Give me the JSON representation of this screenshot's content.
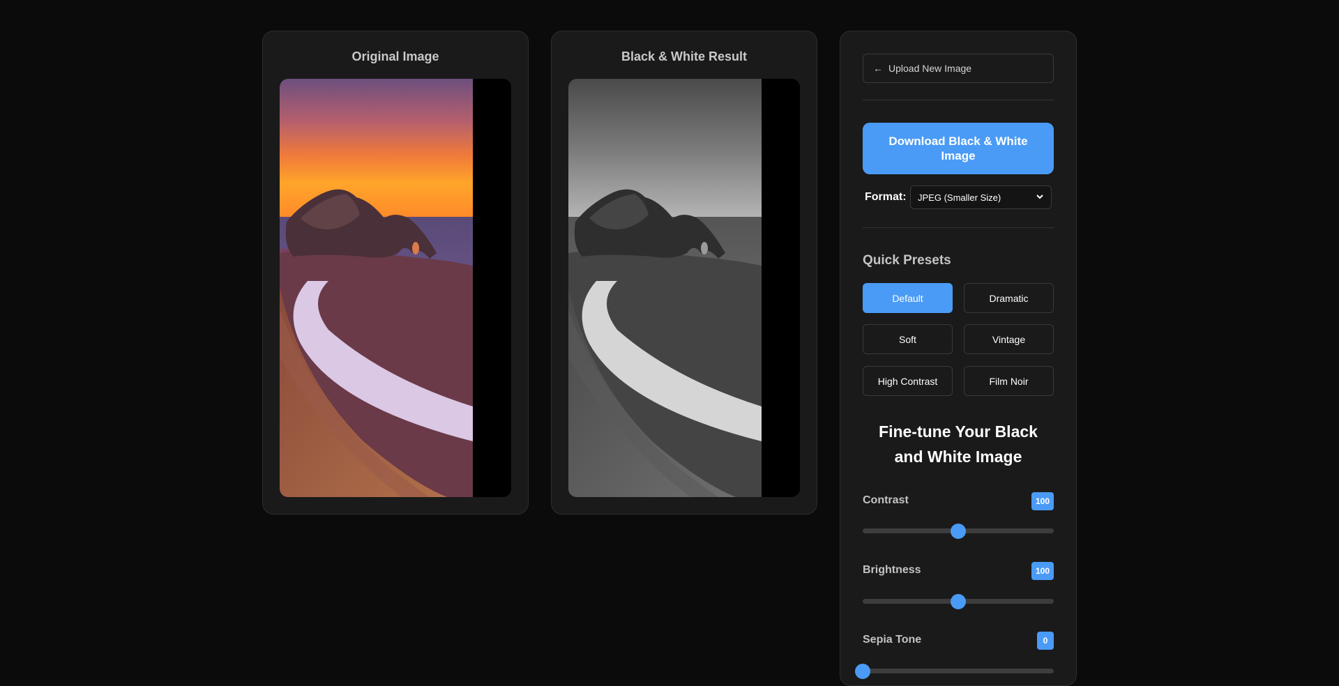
{
  "original_panel": {
    "title": "Original Image"
  },
  "result_panel": {
    "title": "Black & White Result"
  },
  "controls": {
    "upload_label": "Upload New Image",
    "upload_icon": "arrow-left-icon",
    "download_label": "Download Black & White Image",
    "format_label": "Format:",
    "format_value": "JPEG (Smaller Size)",
    "presets_title": "Quick Presets",
    "presets": [
      {
        "label": "Default",
        "active": true
      },
      {
        "label": "Dramatic",
        "active": false
      },
      {
        "label": "Soft",
        "active": false
      },
      {
        "label": "Vintage",
        "active": false
      },
      {
        "label": "High Contrast",
        "active": false
      },
      {
        "label": "Film Noir",
        "active": false
      }
    ],
    "fine_tune_title": "Fine-tune Your Black and White Image",
    "sliders": [
      {
        "label": "Contrast",
        "value": "100",
        "level": 0.5
      },
      {
        "label": "Brightness",
        "value": "100",
        "level": 0.5
      },
      {
        "label": "Sepia Tone",
        "value": "0",
        "level": 0.0
      }
    ]
  },
  "colors": {
    "accent": "#4a9bf5",
    "background": "#0b0b0b",
    "panel": "#1a1a1a"
  }
}
